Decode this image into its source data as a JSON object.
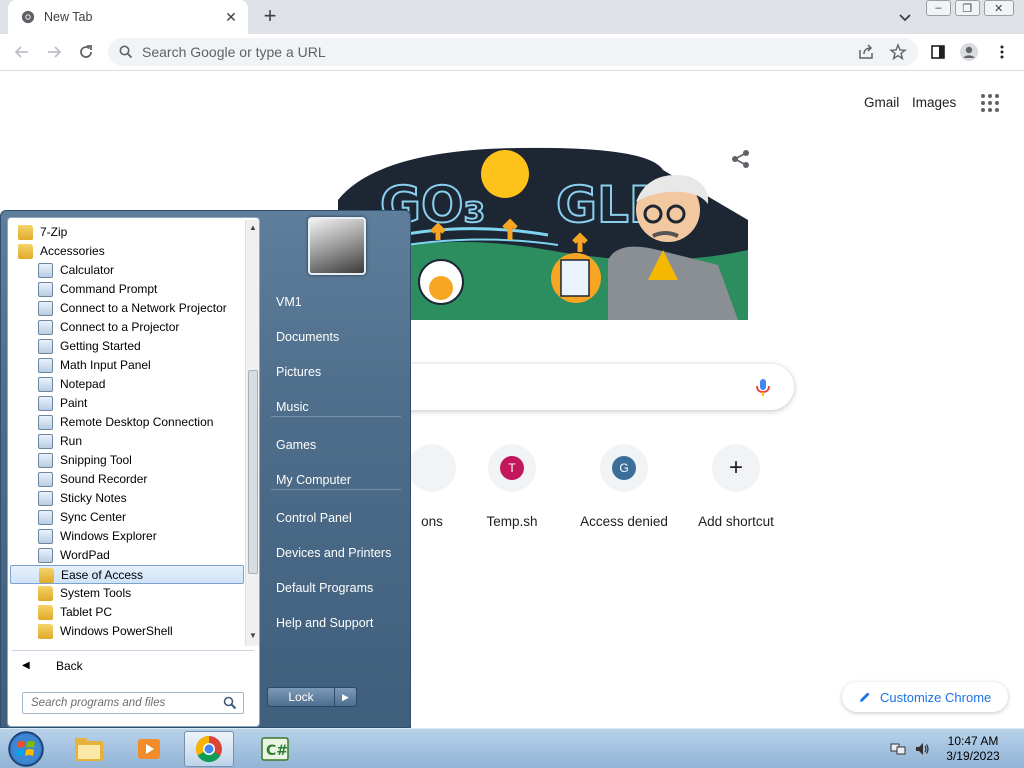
{
  "browser": {
    "tab_title": "New Tab",
    "omnibox_placeholder": "Search Google or type a URL"
  },
  "ntp": {
    "top_links": [
      "Gmail",
      "Images"
    ],
    "shortcuts": [
      {
        "label": "ons",
        "letter": "",
        "color": ""
      },
      {
        "label": "Temp.sh",
        "letter": "T",
        "color": "#c2185b"
      },
      {
        "label": "Access denied",
        "letter": "G",
        "color": "#3c6e9a"
      },
      {
        "label": "Add shortcut",
        "letter": "+",
        "color": ""
      }
    ],
    "customize_label": "Customize Chrome"
  },
  "start_menu": {
    "programs": [
      {
        "label": "7-Zip",
        "type": "folder",
        "indent": 0
      },
      {
        "label": "Accessories",
        "type": "folder",
        "indent": 0
      },
      {
        "label": "Calculator",
        "type": "app",
        "indent": 1
      },
      {
        "label": "Command Prompt",
        "type": "app",
        "indent": 1
      },
      {
        "label": "Connect to a Network Projector",
        "type": "app",
        "indent": 1
      },
      {
        "label": "Connect to a Projector",
        "type": "app",
        "indent": 1
      },
      {
        "label": "Getting Started",
        "type": "app",
        "indent": 1
      },
      {
        "label": "Math Input Panel",
        "type": "app",
        "indent": 1
      },
      {
        "label": "Notepad",
        "type": "app",
        "indent": 1
      },
      {
        "label": "Paint",
        "type": "app",
        "indent": 1
      },
      {
        "label": "Remote Desktop Connection",
        "type": "app",
        "indent": 1
      },
      {
        "label": "Run",
        "type": "app",
        "indent": 1
      },
      {
        "label": "Snipping Tool",
        "type": "app",
        "indent": 1
      },
      {
        "label": "Sound Recorder",
        "type": "app",
        "indent": 1
      },
      {
        "label": "Sticky Notes",
        "type": "app",
        "indent": 1
      },
      {
        "label": "Sync Center",
        "type": "app",
        "indent": 1
      },
      {
        "label": "Windows Explorer",
        "type": "app",
        "indent": 1
      },
      {
        "label": "WordPad",
        "type": "app",
        "indent": 1
      },
      {
        "label": "Ease of Access",
        "type": "folder",
        "indent": 1,
        "selected": true
      },
      {
        "label": "System Tools",
        "type": "folder",
        "indent": 1
      },
      {
        "label": "Tablet PC",
        "type": "folder",
        "indent": 1
      },
      {
        "label": "Windows PowerShell",
        "type": "folder",
        "indent": 1
      }
    ],
    "back_label": "Back",
    "search_placeholder": "Search programs and files",
    "right_items": [
      {
        "label": "VM1",
        "group": 0
      },
      {
        "label": "Documents",
        "group": 0
      },
      {
        "label": "Pictures",
        "group": 0
      },
      {
        "label": "Music",
        "group": 0
      },
      {
        "label": "Games",
        "group": 1
      },
      {
        "label": "My Computer",
        "group": 1
      },
      {
        "label": "Control Panel",
        "group": 2
      },
      {
        "label": "Devices and Printers",
        "group": 2
      },
      {
        "label": "Default Programs",
        "group": 2
      },
      {
        "label": "Help and Support",
        "group": 2
      }
    ],
    "lock_label": "Lock"
  },
  "taskbar": {
    "time": "10:47 AM",
    "date": "3/19/2023"
  },
  "colors": {
    "chrome_blue": "#1a73e8",
    "start_menu_bg": "#4d6d8a",
    "taskbar_bg": "#a4c2e0"
  }
}
